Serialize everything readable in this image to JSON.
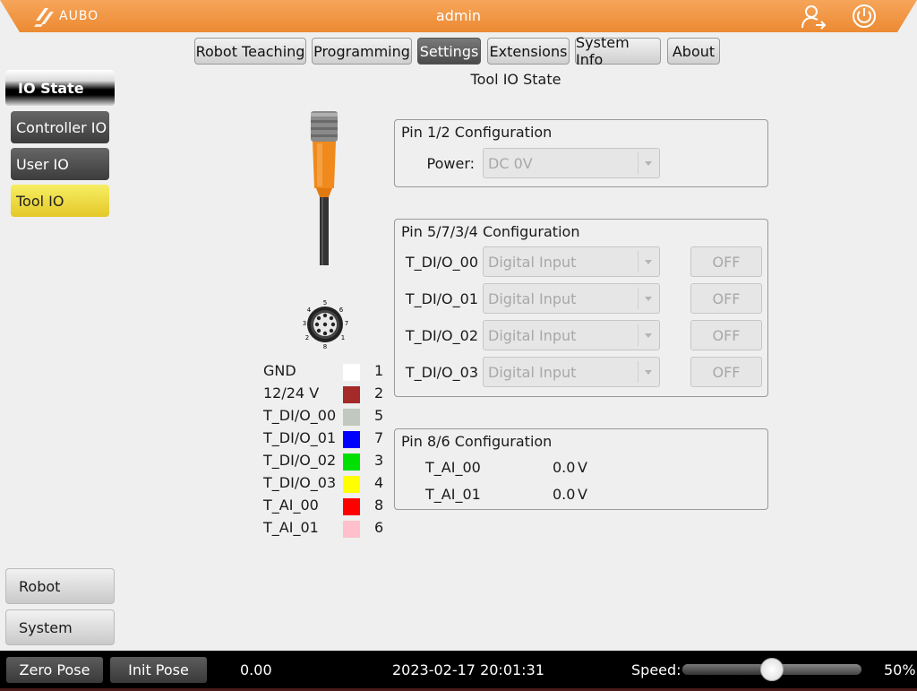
{
  "header": {
    "logo_text": "AUBO",
    "title": "admin",
    "user_icon": "user-logout-icon",
    "power_icon": "power-icon"
  },
  "tabs": [
    {
      "label": "Robot Teaching",
      "active": false
    },
    {
      "label": "Programming",
      "active": false
    },
    {
      "label": "Settings",
      "active": true
    },
    {
      "label": "Extensions",
      "active": false
    },
    {
      "label": "System Info",
      "active": false
    },
    {
      "label": "About",
      "active": false
    }
  ],
  "page_title": "Tool IO State",
  "sidebar": {
    "header": "IO State",
    "items": [
      {
        "label": "Controller IO",
        "active": false
      },
      {
        "label": "User IO",
        "active": false
      },
      {
        "label": "Tool IO",
        "active": true
      }
    ],
    "bottom": [
      {
        "label": "Robot"
      },
      {
        "label": "System"
      }
    ]
  },
  "connector": {
    "pin_numbers": [
      "5",
      "4",
      "6",
      "3",
      "7",
      "2",
      "1",
      "8"
    ]
  },
  "pin_legend": [
    {
      "name": "GND",
      "color": "#ffffff",
      "pin": "1"
    },
    {
      "name": "12/24 V",
      "color": "#a52a2a",
      "pin": "2"
    },
    {
      "name": "T_DI/O_00",
      "color": "#c0c8c0",
      "pin": "5"
    },
    {
      "name": "T_DI/O_01",
      "color": "#0000ff",
      "pin": "7"
    },
    {
      "name": "T_DI/O_02",
      "color": "#00e000",
      "pin": "3"
    },
    {
      "name": "T_DI/O_03",
      "color": "#ffff00",
      "pin": "4"
    },
    {
      "name": "T_AI_00",
      "color": "#ff0000",
      "pin": "8"
    },
    {
      "name": "T_AI_01",
      "color": "#ffc0cb",
      "pin": "6"
    }
  ],
  "pin12": {
    "title": "Pin 1/2 Configuration",
    "power_label": "Power:",
    "power_value": "DC 0V"
  },
  "pin5734": {
    "title": "Pin 5/7/3/4  Configuration",
    "rows": [
      {
        "label": "T_DI/O_00",
        "mode": "Digital Input",
        "state": "OFF"
      },
      {
        "label": "T_DI/O_01",
        "mode": "Digital Input",
        "state": "OFF"
      },
      {
        "label": "T_DI/O_02",
        "mode": "Digital Input",
        "state": "OFF"
      },
      {
        "label": "T_DI/O_03",
        "mode": "Digital Input",
        "state": "OFF"
      }
    ]
  },
  "pin86": {
    "title": "Pin 8/6 Configuration",
    "rows": [
      {
        "label": "T_AI_00",
        "value": "0.0",
        "unit": "V"
      },
      {
        "label": "T_AI_01",
        "value": "0.0",
        "unit": "V"
      }
    ]
  },
  "bottom_bar": {
    "zero_pose": "Zero Pose",
    "init_pose": "Init Pose",
    "value": "0.00",
    "datetime": "2023-02-17 20:01:31",
    "speed_label": "Speed:",
    "speed_value": "50%",
    "speed_fraction": 0.5
  }
}
